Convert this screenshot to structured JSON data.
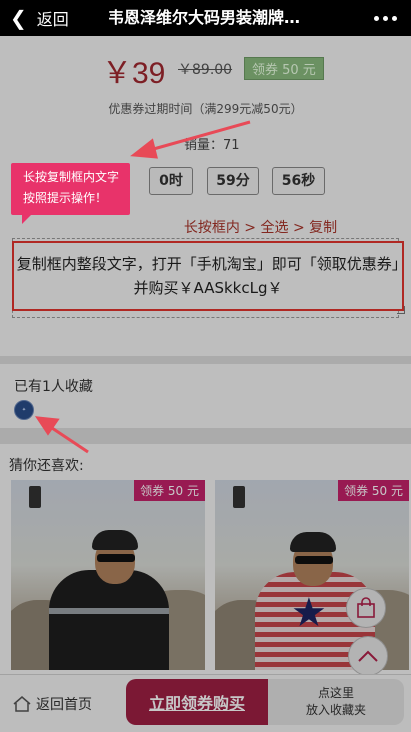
{
  "topbar": {
    "back_label": "返回",
    "title": "韦恩泽维尔大码男装潮牌…"
  },
  "coupon": {
    "price": "￥39",
    "original_price": "￥89.00",
    "coupon_tag": "领券 50 元",
    "expire_text": "优惠券过期时间（满299元减50元）",
    "sales_text": "销量：71",
    "timer": [
      "0时",
      "59分",
      "56秒"
    ],
    "timer_hidden_first": "0",
    "instruction": "长按框内 > 全选 > 复制",
    "copy_text": "复制框内整段文字，打开「手机淘宝」即可「领取优惠券」并购买￥AASkkcLg￥"
  },
  "tooltip": {
    "line1": "长按复制框内文字",
    "line2": "按照提示操作！"
  },
  "collect": {
    "label": "已有1人收藏"
  },
  "recommend": {
    "label": "猜你还喜欢:",
    "items": [
      {
        "badge": "领券 50 元"
      },
      {
        "badge": "领券 50 元"
      }
    ]
  },
  "bottom": {
    "home_label": "返回首页",
    "buy_label": "立即领券购买",
    "fav_line1": "点这里",
    "fav_line2": "放入收藏夹"
  },
  "colors": {
    "price": "#a02830",
    "tooltip": "#e8336a",
    "buy": "#9e1f43",
    "copy_border": "#e2342d"
  },
  "icons": [
    "chevron-left-icon",
    "more-icon",
    "home-icon",
    "bag-icon",
    "chevron-up-icon"
  ]
}
